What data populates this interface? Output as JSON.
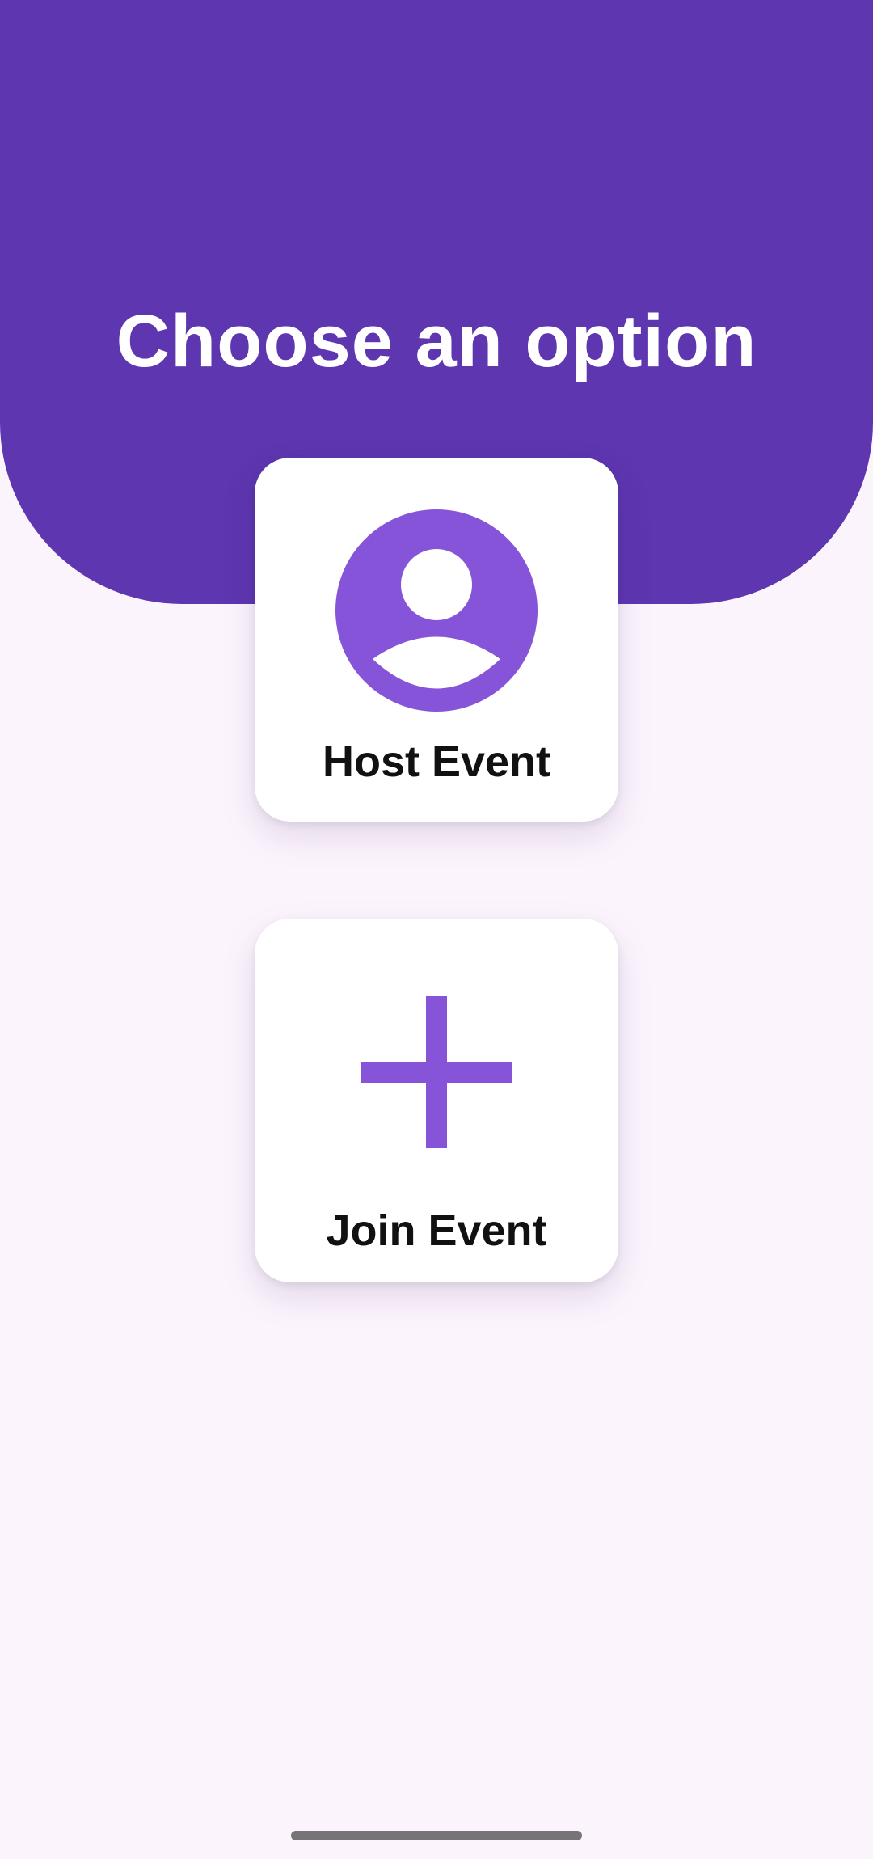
{
  "header": {
    "title": "Choose an option",
    "background_color": "#5d36b0"
  },
  "options": [
    {
      "label": "Host Event",
      "icon": "account-circle-icon"
    },
    {
      "label": "Join Event",
      "icon": "plus-icon"
    }
  ],
  "colors": {
    "accent": "#8654d8",
    "page_background": "#fcf4fd",
    "card_background": "#ffffff"
  }
}
